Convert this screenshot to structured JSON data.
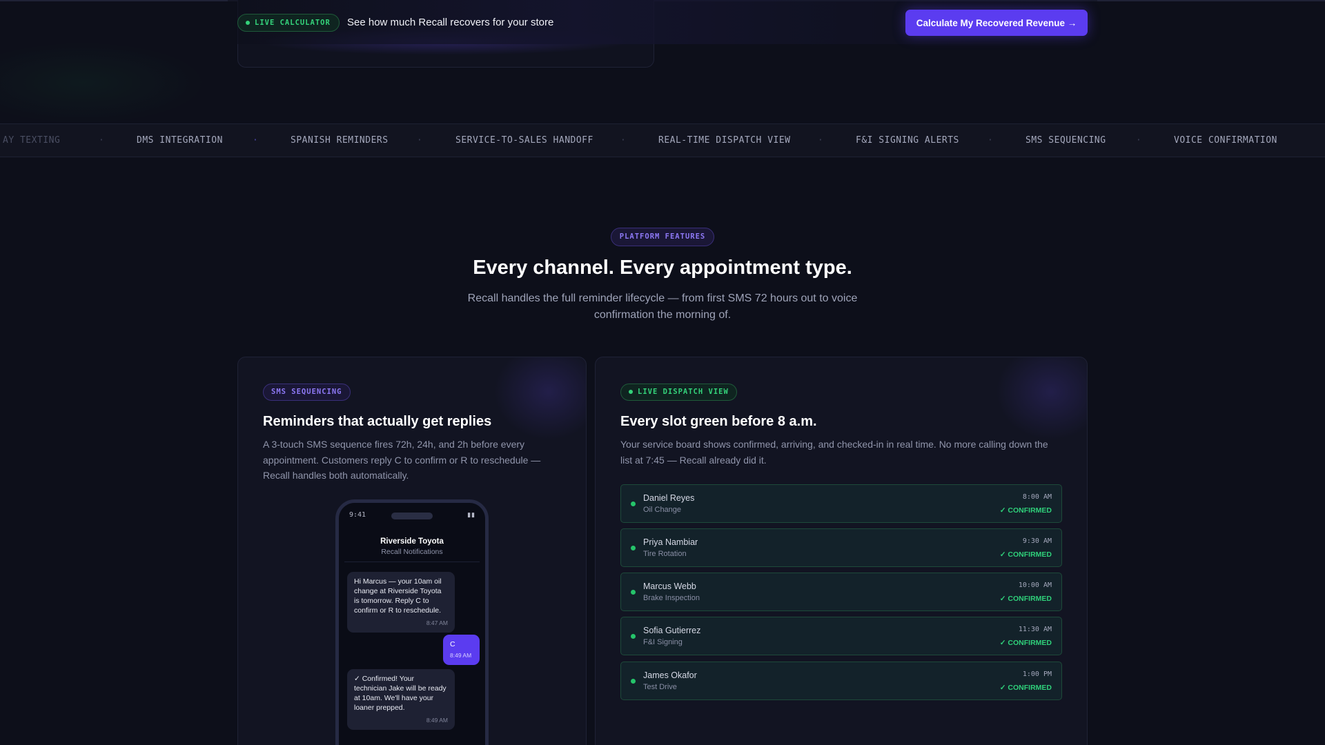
{
  "top_bar": {
    "live_badge": "LIVE CALCULATOR",
    "tagline": "See how much Recall recovers for your store",
    "cta_label": "Calculate My Recovered Revenue →"
  },
  "ticker": {
    "items": [
      "AY TEXTING",
      "DMS INTEGRATION",
      "SPANISH REMINDERS",
      "SERVICE-TO-SALES HANDOFF",
      "REAL-TIME DISPATCH VIEW",
      "F&I SIGNING ALERTS",
      "SMS SEQUENCING",
      "VOICE CONFIRMATION"
    ],
    "separator": "·"
  },
  "features": {
    "badge": "PLATFORM FEATURES",
    "title": "Every channel. Every appointment type.",
    "subtitle": "Recall handles the full reminder lifecycle — from first SMS 72 hours out to voice confirmation the morning of."
  },
  "sms_card": {
    "tag": "SMS SEQUENCING",
    "title": "Reminders that actually get replies",
    "description": "A 3-touch SMS sequence fires 72h, 24h, and 2h before every appointment. Customers reply C to confirm or R to reschedule — Recall handles both automatically.",
    "phone": {
      "time": "9:41",
      "signal": "▮▮",
      "dealer_name": "Riverside Toyota",
      "channel": "Recall Notifications",
      "messages": [
        {
          "text": "Hi Marcus — your 10am oil change at Riverside Toyota is tomorrow. Reply C to confirm or R to reschedule.",
          "time": "8:47 AM"
        },
        {
          "text": "C",
          "time": "8:49 AM"
        },
        {
          "text": "✓ Confirmed! Your technician Jake will be ready at 10am. We'll have your loaner prepped.",
          "time": "8:49 AM"
        }
      ]
    }
  },
  "dispatch_card": {
    "tag": "LIVE DISPATCH VIEW",
    "title": "Every slot green before 8 a.m.",
    "description": "Your service board shows confirmed, arriving, and checked-in in real time. No more calling down the list at 7:45 — Recall already did it.",
    "rows": [
      {
        "name": "Daniel Reyes",
        "service": "Oil Change",
        "time": "8:00 AM",
        "status": "✓ CONFIRMED"
      },
      {
        "name": "Priya Nambiar",
        "service": "Tire Rotation",
        "time": "9:30 AM",
        "status": "✓ CONFIRMED"
      },
      {
        "name": "Marcus Webb",
        "service": "Brake Inspection",
        "time": "10:00 AM",
        "status": "✓ CONFIRMED"
      },
      {
        "name": "Sofia Gutierrez",
        "service": "F&I Signing",
        "time": "11:30 AM",
        "status": "✓ CONFIRMED"
      },
      {
        "name": "James Okafor",
        "service": "Test Drive",
        "time": "1:00 PM",
        "status": "✓ CONFIRMED"
      }
    ]
  },
  "colors": {
    "background": "#0d0f1a",
    "accent_purple": "#5b3cf0",
    "accent_green": "#34d27a",
    "card": "#121422"
  }
}
